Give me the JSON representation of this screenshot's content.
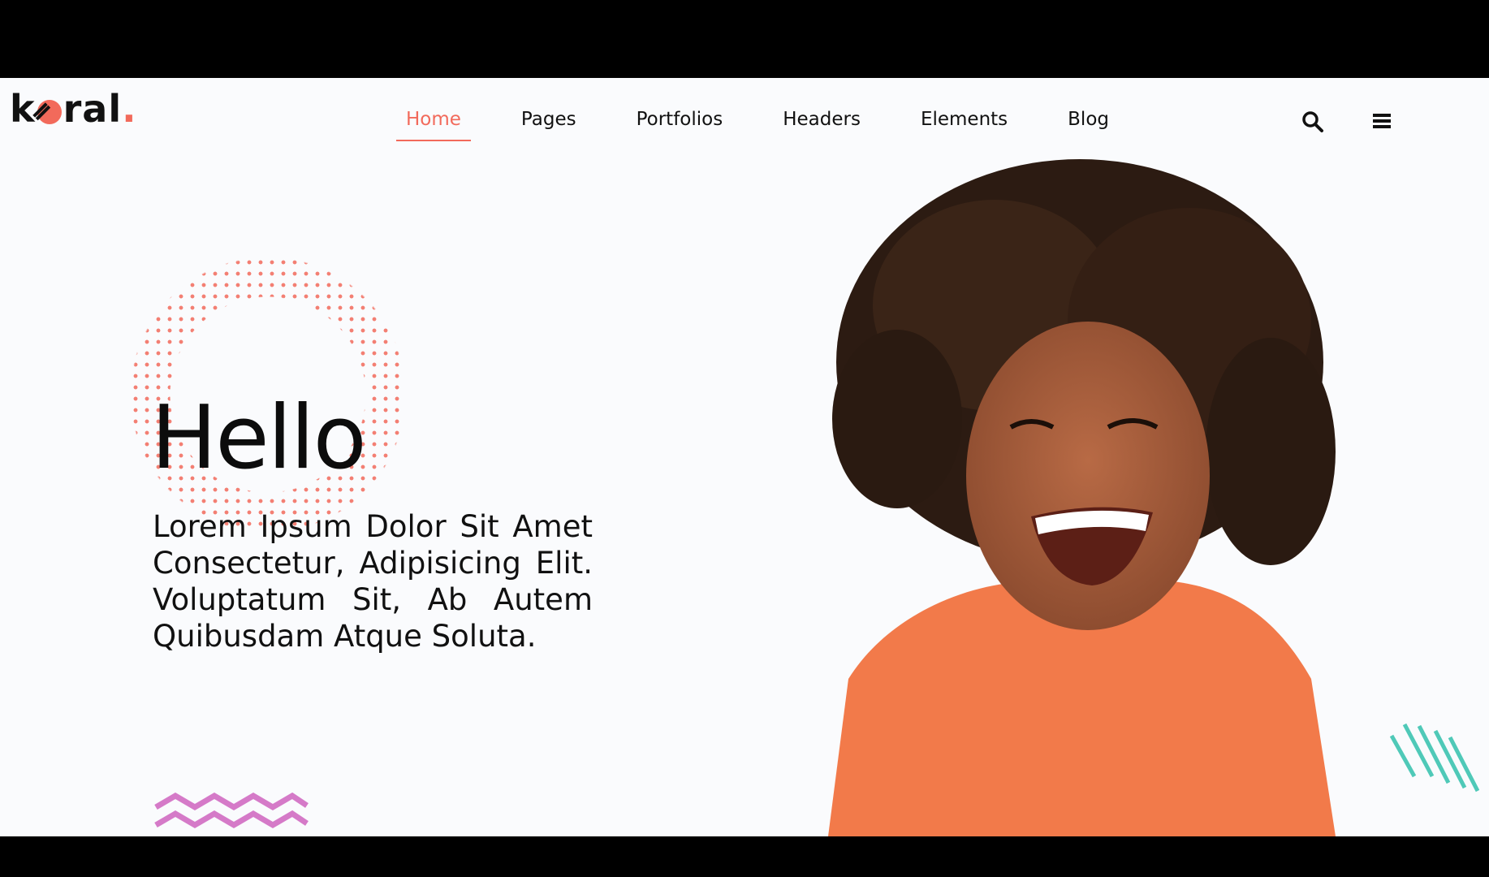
{
  "header": {
    "logo_text": "koral",
    "logo_accent": ".",
    "nav": [
      {
        "label": "Home",
        "active": true
      },
      {
        "label": "Pages"
      },
      {
        "label": "Portfolios"
      },
      {
        "label": "Headers"
      },
      {
        "label": "Elements"
      },
      {
        "label": "Blog"
      }
    ],
    "icons": {
      "search": "search-icon",
      "menu": "hamburger-menu-icon"
    }
  },
  "hero": {
    "title": "Hello",
    "text": "Lorem Ipsum Dolor Sit Amet Consectetur, Adipisicing Elit. Voluptatum Sit, Ab Autem Quibusdam Atque Soluta."
  },
  "colors": {
    "accent": "#f26a5b",
    "text": "#111111",
    "background": "#fafbfd",
    "zigzag": "#d57ac8",
    "stripes": "#4fc9b8",
    "sweater": "#f27a4a"
  }
}
